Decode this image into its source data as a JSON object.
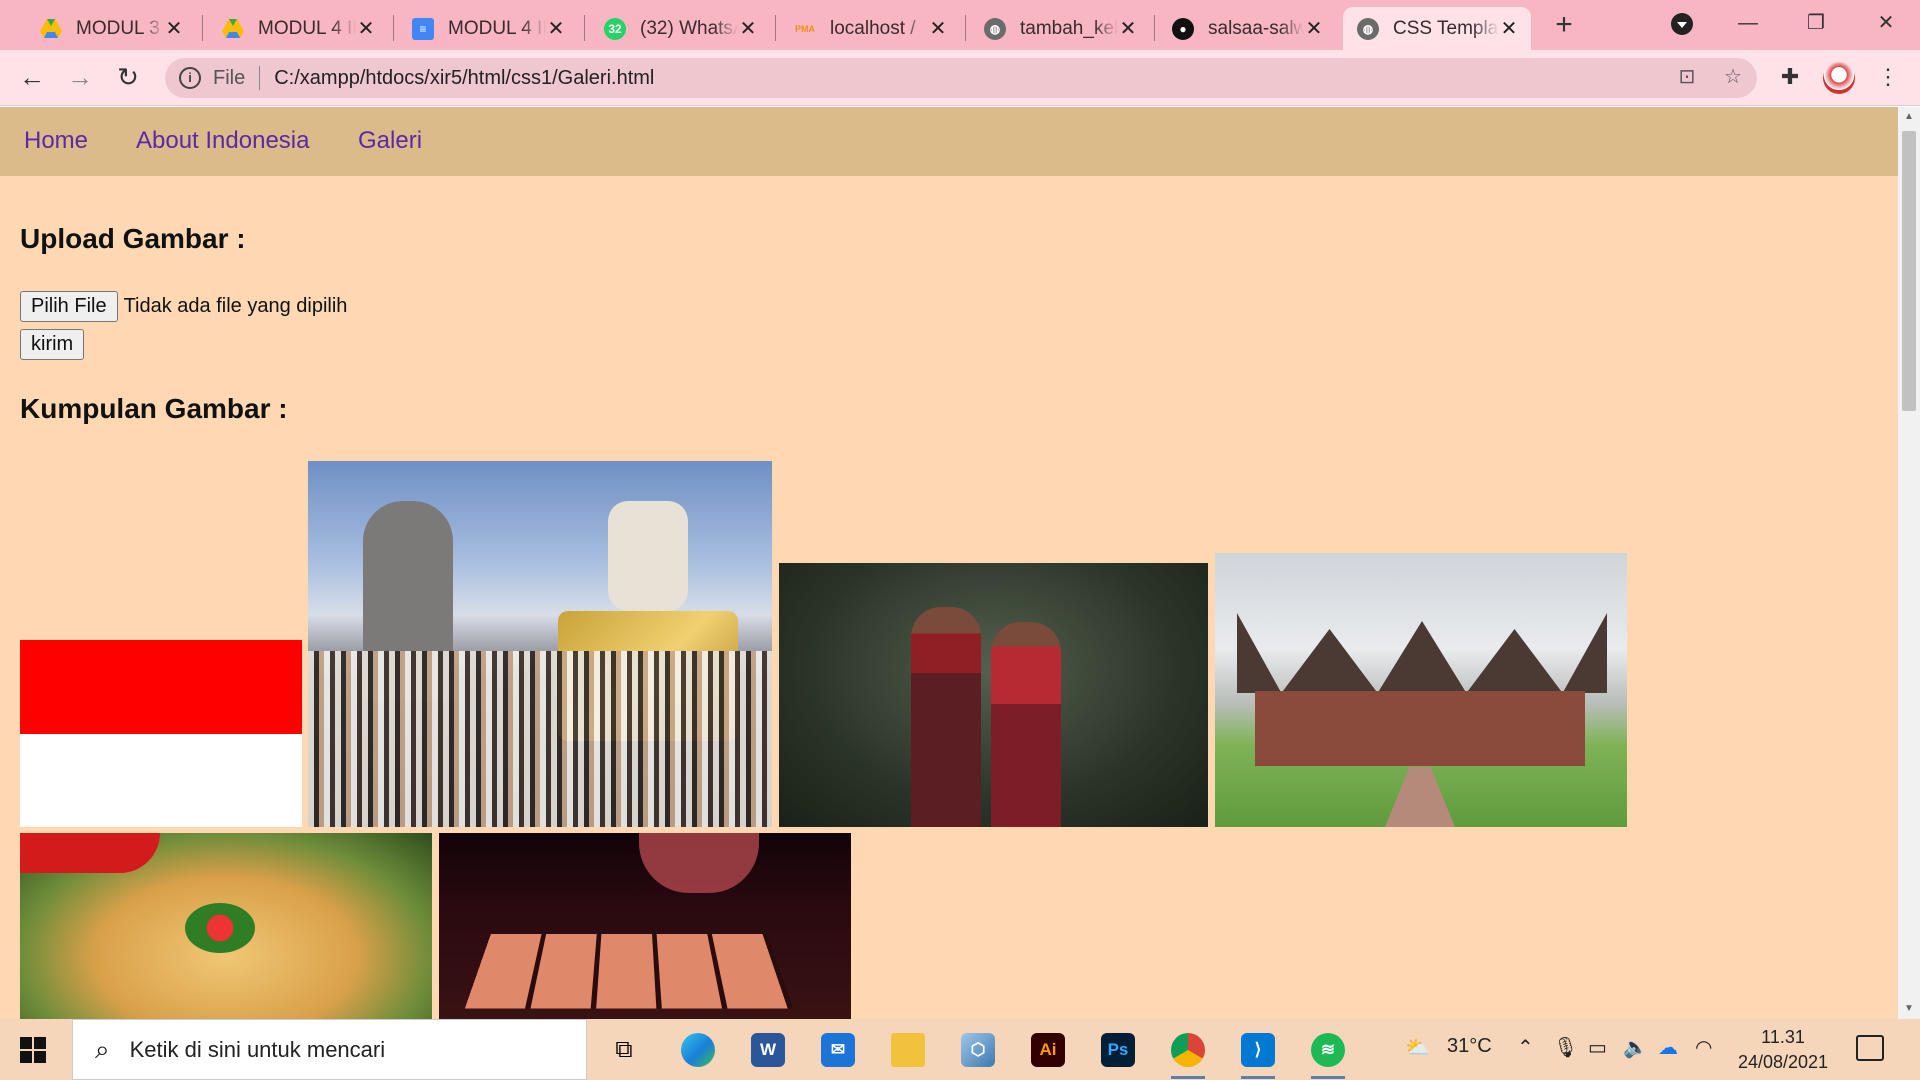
{
  "browser": {
    "tabs": [
      {
        "title": "MODUL 3 K",
        "icon": "google-drive-icon",
        "color": "#1fa463"
      },
      {
        "title": "MODUL 4 IN",
        "icon": "google-drive-icon",
        "color": "#1fa463"
      },
      {
        "title": "MODUL 4 IN",
        "icon": "google-docs-icon",
        "color": "#4285f4"
      },
      {
        "title": "(32) WhatsA",
        "icon": "whatsapp-icon",
        "color": "#25d366",
        "badge": "32"
      },
      {
        "title": "localhost /",
        "icon": "phpmyadmin-icon",
        "color": "#f29111",
        "badge": "PMA"
      },
      {
        "title": "tambah_kel",
        "icon": "globe-icon",
        "color": "#5f6368"
      },
      {
        "title": "salsaa-salw",
        "icon": "github-icon",
        "color": "#111111"
      },
      {
        "title": "CSS Templa",
        "icon": "globe-icon",
        "color": "#5f6368",
        "active": true
      }
    ],
    "address_prefix": "File",
    "url": "C:/xampp/htdocs/xir5/html/css1/Galeri.html"
  },
  "site": {
    "nav": [
      "Home",
      "About Indonesia",
      "Galeri"
    ],
    "upload_heading": "Upload Gambar :",
    "file_button": "Pilih File",
    "no_file_text": "Tidak ada file yang dipilih",
    "submit_button": "kirim",
    "gallery_heading": "Kumpulan Gambar :",
    "gallery": [
      {
        "name": "indonesia-flag-image"
      },
      {
        "name": "bali-ceremony-image"
      },
      {
        "name": "traditional-couple-image"
      },
      {
        "name": "rumah-gadang-image"
      },
      {
        "name": "food-image"
      },
      {
        "name": "instrument-image"
      }
    ]
  },
  "taskbar": {
    "search_placeholder": "Ketik di sini untuk mencari",
    "weather": "31°C",
    "time": "11.31",
    "date": "24/08/2021"
  }
}
